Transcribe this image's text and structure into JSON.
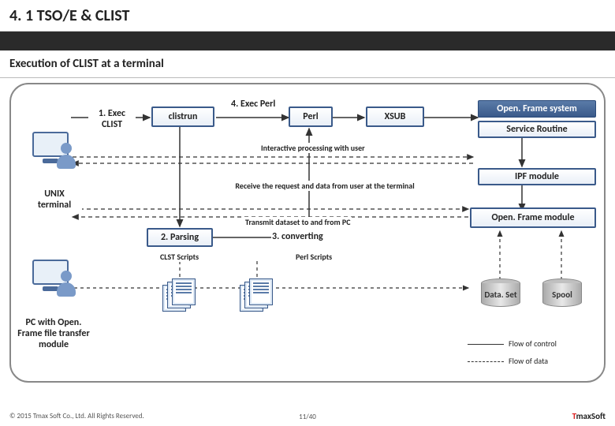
{
  "header": {
    "title": "4. 1 TSO/E & CLIST"
  },
  "subtitle": "Execution of CLIST at a terminal",
  "nodes": {
    "exec_clist": "1. Exec CLIST",
    "clistrun": "clistrun",
    "exec_perl": "4. Exec Perl",
    "perl": "Perl",
    "xsub": "XSUB",
    "of_system": "Open. Frame system",
    "service_routine": "Service Routine",
    "ipf_module": "IPF module",
    "of_module": "Open. Frame module",
    "unix_terminal": "UNIX terminal",
    "parsing": "2. Parsing",
    "converting": "3. converting",
    "clst_scripts": "CLST Scripts",
    "perl_scripts": "Perl Scripts",
    "dataset": "Data. Set",
    "spool": "Spool",
    "pc_label": "PC with Open. Frame file transfer module"
  },
  "annotations": {
    "interactive": "Interactive processing with user",
    "receive": "Receive the request and data from user at the terminal",
    "transmit": "Transmit dataset to and from PC"
  },
  "legend": {
    "control": "Flow of control",
    "data": "Flow of data"
  },
  "footer": {
    "copyright": "© 2015 Tmax Soft Co., Ltd. All Rights Reserved.",
    "page": "11/40",
    "brand_t": "T",
    "brand_rest": "maxSoft"
  }
}
